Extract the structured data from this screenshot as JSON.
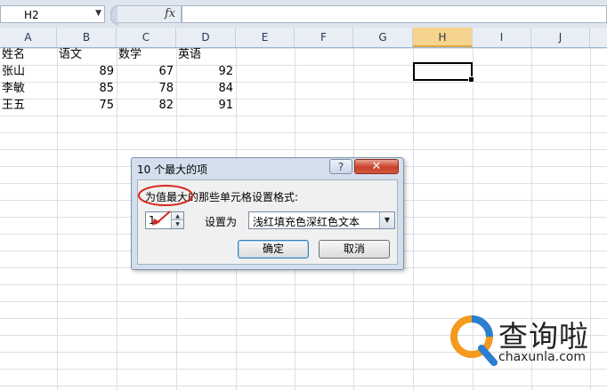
{
  "formula_bar": {
    "name_box": "H2",
    "fx_label": "fx",
    "formula": ""
  },
  "columns": [
    "A",
    "B",
    "C",
    "D",
    "E",
    "F",
    "G",
    "H",
    "I",
    "J"
  ],
  "active_column": "H",
  "sheet": {
    "rows": [
      [
        "姓名",
        "语文",
        "数学",
        "英语"
      ],
      [
        "张山",
        "89",
        "67",
        "92"
      ],
      [
        "李敏",
        "85",
        "78",
        "84"
      ],
      [
        "王五",
        "75",
        "82",
        "91"
      ]
    ]
  },
  "dialog": {
    "title": "10 个最大的项",
    "help_label": "?",
    "close_label": "✕",
    "prompt": "为值最大的那些单元格设置格式:",
    "count_value": "1",
    "set_as_label": "设置为",
    "format_value": "浅红填充色深红色文本",
    "ok_label": "确定",
    "cancel_label": "取消"
  },
  "watermark": {
    "text": "查询啦",
    "url": "chaxunla.com"
  },
  "colors": {
    "annotation_red": "#d7261e",
    "watermark_orange": "#f39a1f",
    "watermark_blue": "#2a7fd0"
  }
}
